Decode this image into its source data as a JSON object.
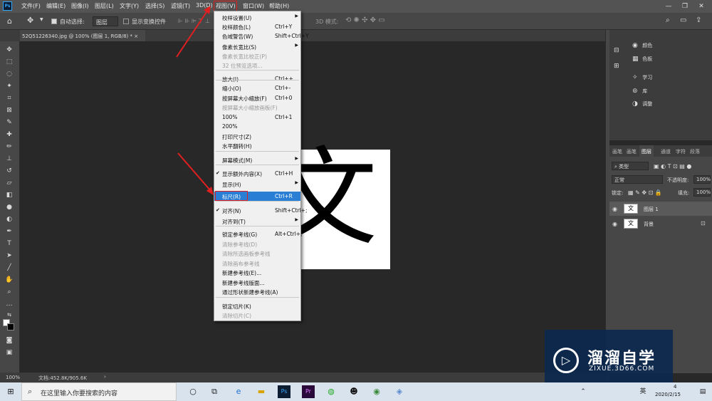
{
  "menubar": {
    "logo": "Ps",
    "items": [
      "文件(F)",
      "编辑(E)",
      "图像(I)",
      "图层(L)",
      "文字(Y)",
      "选择(S)",
      "滤镜(T)",
      "3D(D)",
      "视图(V)",
      "窗口(W)",
      "帮助(H)"
    ],
    "window_controls": [
      "—",
      "❐",
      "✕"
    ]
  },
  "options_bar": {
    "auto_select_label": "自动选择:",
    "auto_select_value": "图层",
    "show_transform_label": "显示变换控件",
    "mode_3d_label": "3D 模式:"
  },
  "document_tab": {
    "title": "52Q5122634​0.jpg @ 100% (图层 1, RGB/8) *",
    "close": "×"
  },
  "view_menu": {
    "items": [
      {
        "label": "校样设置(U)",
        "shortcut": "",
        "submenu": true,
        "disabled": false
      },
      {
        "label": "校样颜色(L)",
        "shortcut": "Ctrl+Y",
        "disabled": false
      },
      {
        "label": "色域警告(W)",
        "shortcut": "Shift+Ctrl+Y",
        "disabled": false
      },
      {
        "label": "像素长宽比(S)",
        "shortcut": "",
        "submenu": true,
        "disabled": false
      },
      {
        "label": "像素长宽比校正(P)",
        "shortcut": "",
        "disabled": true
      },
      {
        "label": "32 位预览选项...",
        "shortcut": "",
        "disabled": true
      },
      {
        "label": "放大(I)",
        "shortcut": "Ctrl++",
        "disabled": false
      },
      {
        "label": "缩小(O)",
        "shortcut": "Ctrl+-",
        "disabled": false
      },
      {
        "label": "按屏幕大小缩放(F)",
        "shortcut": "Ctrl+0",
        "disabled": false
      },
      {
        "label": "按屏幕大小缩放画板(F)",
        "shortcut": "",
        "disabled": true
      },
      {
        "label": "100%",
        "shortcut": "Ctrl+1",
        "disabled": false
      },
      {
        "label": "200%",
        "shortcut": "",
        "disabled": false
      },
      {
        "label": "打印尺寸(Z)",
        "shortcut": "",
        "disabled": false
      },
      {
        "label": "水平翻转(H)",
        "shortcut": "",
        "disabled": false
      },
      {
        "label": "屏幕模式(M)",
        "shortcut": "",
        "submenu": true,
        "disabled": false
      },
      {
        "label": "显示额外内容(X)",
        "shortcut": "Ctrl+H",
        "checked": true,
        "disabled": false
      },
      {
        "label": "显示(H)",
        "shortcut": "",
        "submenu": true,
        "disabled": false
      },
      {
        "label": "标尺(R)",
        "shortcut": "Ctrl+R",
        "disabled": false,
        "highlighted": true
      },
      {
        "label": "对齐(N)",
        "shortcut": "Shift+Ctrl+;",
        "checked": true,
        "disabled": false
      },
      {
        "label": "对齐到(T)",
        "shortcut": "",
        "submenu": true,
        "disabled": false
      },
      {
        "label": "锁定参考线(G)",
        "shortcut": "Alt+Ctrl+;",
        "disabled": false
      },
      {
        "label": "清除参考线(D)",
        "shortcut": "",
        "disabled": true
      },
      {
        "label": "清除所选画板参考线",
        "shortcut": "",
        "disabled": true
      },
      {
        "label": "清除画布参考线",
        "shortcut": "",
        "disabled": true
      },
      {
        "label": "新建参考线(E)...",
        "shortcut": "",
        "disabled": false
      },
      {
        "label": "新建参考线版面...",
        "shortcut": "",
        "disabled": false
      },
      {
        "label": "通过形状新建参考线(A)",
        "shortcut": "",
        "disabled": false
      },
      {
        "label": "锁定切片(K)",
        "shortcut": "",
        "disabled": false
      },
      {
        "label": "清除切片(C)",
        "shortcut": "",
        "disabled": true
      }
    ]
  },
  "right_panel": {
    "items": [
      "颜色",
      "色板",
      "学习",
      "库",
      "调整"
    ]
  },
  "layers_panel": {
    "tabs": [
      "画笔",
      "画笔",
      "图层",
      "通道",
      "字符",
      "段落"
    ],
    "filter_label": "类型",
    "blend_mode": "正常",
    "opacity_label": "不透明度:",
    "opacity_value": "100%",
    "lock_label": "锁定:",
    "fill_label": "填充:",
    "fill_value": "100%",
    "layers": [
      {
        "name": "图层 1",
        "thumb": "文"
      },
      {
        "name": "背景",
        "thumb": "文"
      }
    ]
  },
  "status_bar": {
    "zoom": "100%",
    "doc_info": "文档:452.8K/905.6K",
    "arrow": "›"
  },
  "canvas": {
    "glyph": "文"
  },
  "taskbar": {
    "search_placeholder": "在这里输入你要搜索的内容",
    "clock_date": "2020/2/15",
    "ime": "英",
    "clock_time_partial": "4"
  },
  "watermark": {
    "title": "溜溜自学",
    "url": "ZIXUE.3D66.COM"
  },
  "colors": {
    "accent": "#2a7fd4",
    "annotation_red": "#e02020"
  }
}
